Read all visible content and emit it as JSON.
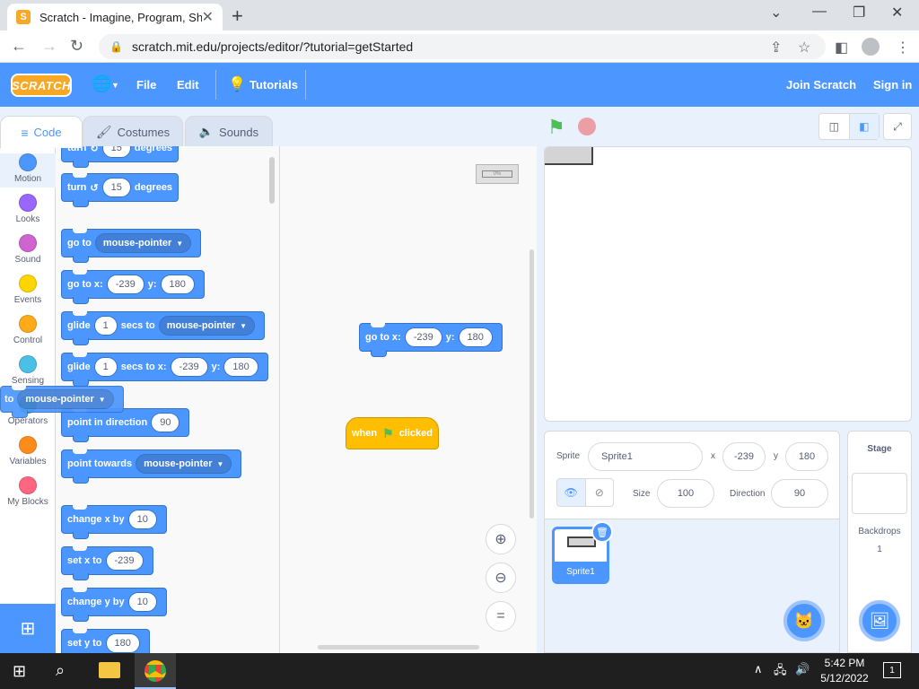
{
  "browser": {
    "tab_title": "Scratch - Imagine, Program, Shar",
    "favicon_letter": "S",
    "url": "scratch.mit.edu/projects/editor/?tutorial=getStarted"
  },
  "menubar": {
    "logo": "SCRATCH",
    "file": "File",
    "edit": "Edit",
    "tutorials": "Tutorials",
    "join": "Join Scratch",
    "signin": "Sign in"
  },
  "editor_tabs": {
    "code": "Code",
    "costumes": "Costumes",
    "sounds": "Sounds"
  },
  "categories": [
    {
      "label": "Motion",
      "color": "#4c97ff"
    },
    {
      "label": "Looks",
      "color": "#9966ff"
    },
    {
      "label": "Sound",
      "color": "#cf63cf"
    },
    {
      "label": "Events",
      "color": "#ffd500"
    },
    {
      "label": "Control",
      "color": "#ffab19"
    },
    {
      "label": "Sensing",
      "color": "#4cbfe6"
    },
    {
      "label": "Operators",
      "color": "#59c059"
    },
    {
      "label": "Variables",
      "color": "#ff8c1a"
    },
    {
      "label": "My Blocks",
      "color": "#ff6680"
    }
  ],
  "palette": {
    "turn_top": {
      "pre": "turn",
      "val": "15",
      "post": "degrees"
    },
    "turn_left": {
      "pre": "turn",
      "val": "15",
      "post": "degrees"
    },
    "go_to": {
      "pre": "go to",
      "drop": "mouse-pointer"
    },
    "go_to_xy": {
      "pre": "go to x:",
      "x": "-239",
      "ylbl": "y:",
      "y": "180"
    },
    "glide_to": {
      "pre": "glide",
      "secs": "1",
      "mid": "secs to",
      "drop": "mouse-pointer"
    },
    "glide_xy": {
      "pre": "glide",
      "secs": "1",
      "mid": "secs to x:",
      "x": "-239",
      "ylbl": "y:",
      "y": "180"
    },
    "point_dir": {
      "pre": "point in direction",
      "val": "90"
    },
    "point_towards": {
      "pre": "point towards",
      "drop": "mouse-pointer"
    },
    "change_x": {
      "pre": "change x by",
      "val": "10"
    },
    "set_x": {
      "pre": "set x to",
      "val": "-239"
    },
    "change_y": {
      "pre": "change y by",
      "val": "10"
    },
    "set_y": {
      "pre": "set y to",
      "val": "180"
    }
  },
  "dragging_block": {
    "pre": "to",
    "drop": "mouse-pointer"
  },
  "workspace": {
    "goto_block": {
      "pre": "go to x:",
      "x": "-239",
      "ylbl": "y:",
      "y": "180"
    },
    "hat_block": {
      "pre": "when",
      "post": "clicked"
    },
    "mini_label": "0%"
  },
  "sprite_info": {
    "sprite_label": "Sprite",
    "sprite_name": "Sprite1",
    "x_label": "x",
    "x": "-239",
    "y_label": "y",
    "y": "180",
    "size_label": "Size",
    "size": "100",
    "direction_label": "Direction",
    "direction": "90"
  },
  "sprite_tile": {
    "name": "Sprite1"
  },
  "stage_panel": {
    "title": "Stage",
    "backdrops_label": "Backdrops",
    "backdrops_count": "1"
  },
  "taskbar": {
    "time": "5:42 PM",
    "date": "5/12/2022",
    "notif_count": "1"
  }
}
